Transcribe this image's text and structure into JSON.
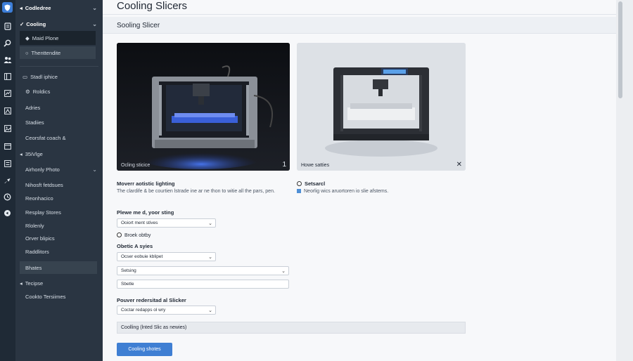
{
  "sidebar": {
    "items": [
      {
        "label": "Codledree",
        "name": "sidebar-item-codledree"
      },
      {
        "label": "Cooling",
        "name": "sidebar-item-cooling"
      },
      {
        "label": "Maid Plone",
        "name": "sidebar-item-maid-plone"
      },
      {
        "label": "Thenttendite",
        "name": "sidebar-item-thenttendite"
      },
      {
        "label": "Stadl iphice",
        "name": "sidebar-item-stadl-iphice"
      },
      {
        "label": "Roldics",
        "name": "sidebar-item-roldics"
      },
      {
        "label": "Adries",
        "name": "sidebar-item-adries"
      },
      {
        "label": "Stadiies",
        "name": "sidebar-item-stadiies"
      },
      {
        "label": "Ceorsfat coach &",
        "name": "sidebar-item-ceorsfat-coach"
      },
      {
        "label": "35iVlge",
        "name": "sidebar-item-35ivlge"
      },
      {
        "label": "Airhonly Photo",
        "name": "sidebar-item-airhonly-photo"
      },
      {
        "label": "Nihosft fetdsues",
        "name": "sidebar-item-nihosft-fetdsues"
      },
      {
        "label": "Reonhacico",
        "name": "sidebar-item-reonhacico"
      },
      {
        "label": "Resplay Stores",
        "name": "sidebar-item-resplay-stores"
      },
      {
        "label": "Rlolenly",
        "name": "sidebar-item-rlolenly"
      },
      {
        "label": "Orver blipics",
        "name": "sidebar-item-orver-blipics"
      },
      {
        "label": "Raddlitors",
        "name": "sidebar-item-raddlitors"
      },
      {
        "label": "Bhates",
        "name": "sidebar-item-bhates"
      },
      {
        "label": "Tecipse",
        "name": "sidebar-item-tecipse"
      },
      {
        "label": "Cookto Tersiimes",
        "name": "sidebar-item-cookto-tersiimes"
      }
    ]
  },
  "main": {
    "app_title": "Cooling Slicers",
    "section_title": "Sooling Slicer",
    "card_left": {
      "caption": "Ocling sticice",
      "mark": "1"
    },
    "card_right": {
      "caption": "Howe satties",
      "mark": "✕"
    },
    "left_block": {
      "heading": "Moverr aotistic lighting",
      "desc": "The clardife & be courtien lstrade ine ar ne thon to witie all the pars, pen."
    },
    "right_block": {
      "heading": "Setsarcl",
      "desc": "Neorlig wics aruortoren io slie afstems."
    },
    "form": {
      "label1": "Plewe me d, yoor sting",
      "select1": "Ooiort ment stives",
      "radio1": "Broek obtby",
      "label2": "Obetic A syies",
      "select2": "Ocser eobuie kblipet",
      "select3": "Setsing",
      "input1": "Sbetle",
      "label3": "Pouver redersitad al Slicker",
      "select4": "Coctar redapps ol wry",
      "readout": "Coolling (lnted Slic as newies)",
      "button": "Cooling shotes"
    }
  }
}
